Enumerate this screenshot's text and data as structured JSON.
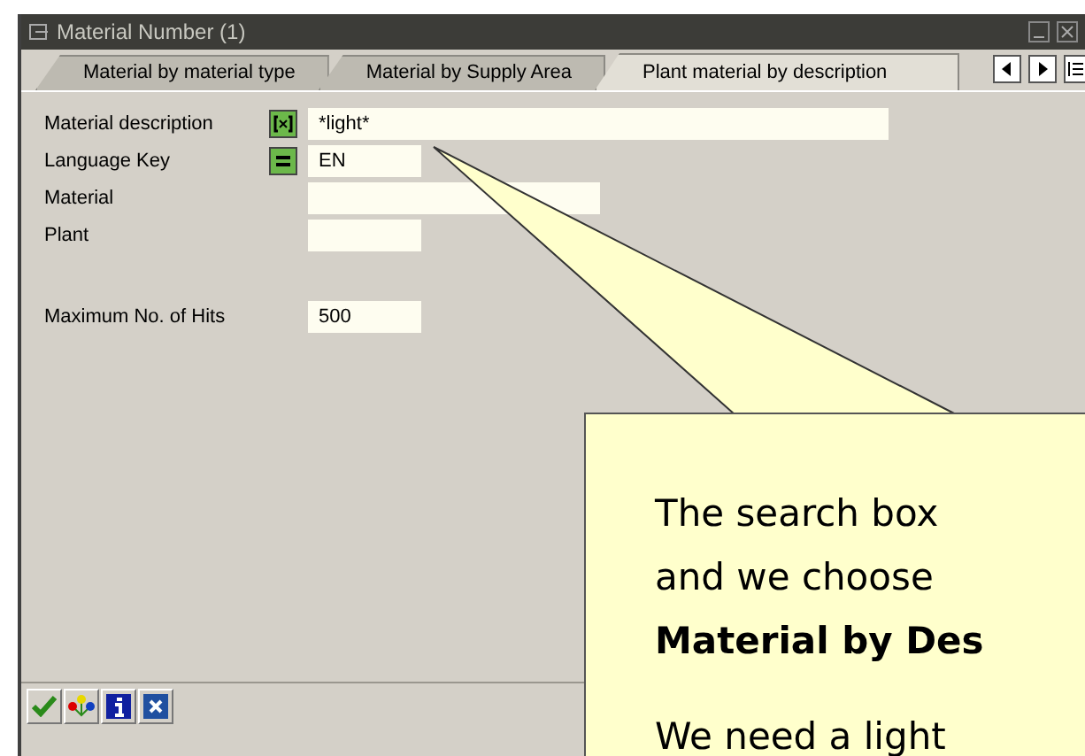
{
  "window": {
    "title": "Material Number (1)"
  },
  "tabs": [
    {
      "label": "Material by material type",
      "selected": false
    },
    {
      "label": "Material by Supply Area",
      "selected": false
    },
    {
      "label": "Plant material by description",
      "selected": true
    }
  ],
  "fields": [
    {
      "label": "Material description",
      "kind": "pattern",
      "value": "*light*"
    },
    {
      "label": "Language Key",
      "kind": "equals",
      "value": "EN"
    },
    {
      "label": "Material",
      "kind": "plain"
    },
    {
      "label": "Plant",
      "kind": "plain"
    }
  ],
  "settings": [
    {
      "label": "Maximum No. of Hits",
      "value": "500"
    }
  ],
  "callout": {
    "paragraphs": [
      [
        "The search box",
        "and we choose",
        "**Material by Des**"
      ],
      [
        "We need a light"
      ]
    ]
  }
}
